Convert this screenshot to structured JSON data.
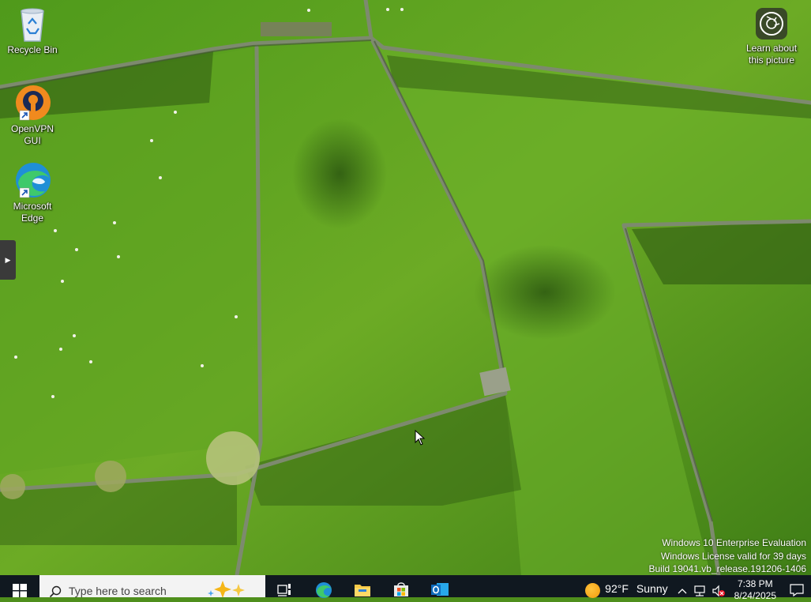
{
  "desktop": {
    "icons": [
      {
        "label": "Recycle Bin",
        "icon": "recycle-bin-icon"
      },
      {
        "label": "OpenVPN GUI",
        "icon": "openvpn-icon"
      },
      {
        "label": "Microsoft Edge",
        "icon": "edge-icon"
      }
    ],
    "learn_about": {
      "label_line1": "Learn about",
      "label_line2": "this picture",
      "icon": "camera-icon"
    },
    "watermark": {
      "line1": "Windows 10 Enterprise Evaluation",
      "line2": "Windows License valid for 39 days",
      "line3": "Build 19041.vb_release.191206-1406"
    }
  },
  "taskbar": {
    "search_placeholder": "Type here to search",
    "apps": [
      {
        "name": "Task View",
        "icon": "task-view-icon"
      },
      {
        "name": "Microsoft Edge",
        "icon": "edge-icon"
      },
      {
        "name": "File Explorer",
        "icon": "folder-icon"
      },
      {
        "name": "Microsoft Store",
        "icon": "store-icon"
      },
      {
        "name": "Outlook",
        "icon": "outlook-icon"
      }
    ],
    "weather": {
      "temp": "92°F",
      "condition": "Sunny"
    },
    "clock": {
      "time": "7:38 PM",
      "date": "8/24/2025"
    }
  },
  "colors": {
    "taskbar": "#101820",
    "grass": "#5a9e1f",
    "shadow": "#2f5a12"
  }
}
